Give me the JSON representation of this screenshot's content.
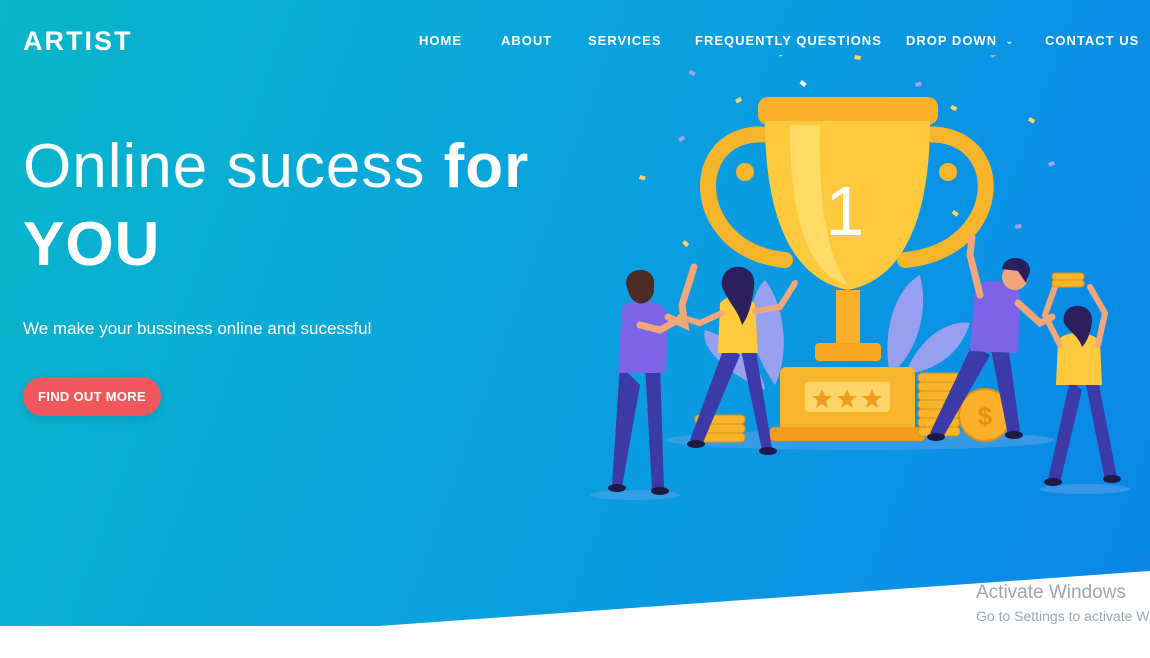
{
  "brand": {
    "logo": "ARTIST"
  },
  "nav": {
    "items": [
      {
        "label": "HOME"
      },
      {
        "label": "ABOUT"
      },
      {
        "label": "SERVICES"
      },
      {
        "label": "FREQUENTLY QUESTIONS"
      },
      {
        "label": "DROP DOWN"
      },
      {
        "label": "CONTACT US"
      }
    ]
  },
  "hero": {
    "headline_light": "Online sucess ",
    "headline_bold_1": "for",
    "headline_bold_2": "YOU",
    "subtitle": "We make your bussiness online and sucessful",
    "cta_label": "FIND OUT MORE",
    "trophy_number": "1"
  },
  "watermark": {
    "title": "Activate Windows",
    "subtitle": "Go to Settings to activate W"
  },
  "colors": {
    "hero_gradient_start": "#08b7c9",
    "hero_gradient_end": "#0a86e8",
    "cta": "#f2575d",
    "trophy": "#ffbf2b",
    "figure_purple": "#7c63e8",
    "figure_pants": "#3b3aa8"
  },
  "icons": {
    "dropdown": "chevron-down-icon"
  }
}
